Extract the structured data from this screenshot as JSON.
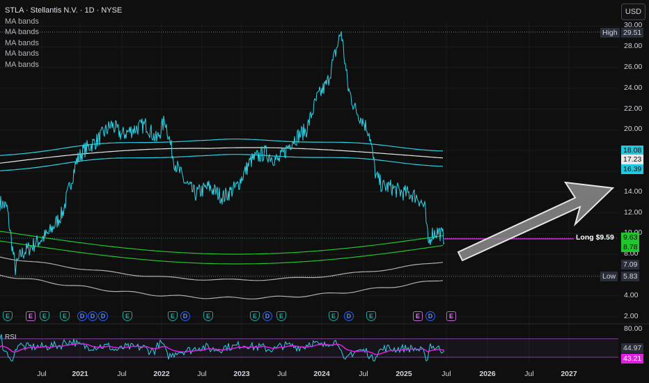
{
  "header": {
    "symbol_line": "STLA · Stellantis N.V. · 1D · NYSE",
    "indicators": [
      "MA bands",
      "MA bands",
      "MA bands",
      "MA bands",
      "MA bands"
    ],
    "currency_button": "USD"
  },
  "price_axis": {
    "ticks": [
      "30.00",
      "28.00",
      "26.00",
      "24.00",
      "22.00",
      "20.00",
      "18.00",
      "16.00",
      "14.00",
      "12.00",
      "10.00",
      "8.00",
      "6.00",
      "4.00",
      "2.00"
    ],
    "tick_values": [
      30,
      28,
      26,
      24,
      22,
      20,
      18,
      16,
      14,
      12,
      10,
      8,
      6,
      4,
      2
    ],
    "high_label": "High",
    "high_value": "29.51",
    "low_label": "Low",
    "low_value": "5.83",
    "band_upper": "18.08",
    "band_mid": "17.23",
    "band_lower": "16.39",
    "current_price": "9.63",
    "green_level": "8.78",
    "gray_level": "7.09"
  },
  "rsi": {
    "label": "RSI",
    "axis_top": "80.00",
    "value_1": "44.97",
    "value_2": "43.21"
  },
  "time_axis": {
    "labels": [
      {
        "text": "Jul",
        "year": false
      },
      {
        "text": "2021",
        "year": true
      },
      {
        "text": "Jul",
        "year": false
      },
      {
        "text": "2022",
        "year": true
      },
      {
        "text": "Jul",
        "year": false
      },
      {
        "text": "2023",
        "year": true
      },
      {
        "text": "Jul",
        "year": false
      },
      {
        "text": "2024",
        "year": true
      },
      {
        "text": "Jul",
        "year": false
      },
      {
        "text": "2025",
        "year": true
      },
      {
        "text": "Jul",
        "year": false
      },
      {
        "text": "2026",
        "year": true
      },
      {
        "text": "Jul",
        "year": false
      },
      {
        "text": "2027",
        "year": true
      }
    ]
  },
  "events": [
    "E",
    "E",
    "E",
    "E",
    "D",
    "D",
    "D",
    "E",
    "E",
    "D",
    "E",
    "E",
    "D",
    "E",
    "E",
    "D",
    "E",
    "E",
    "D",
    "E"
  ],
  "annotation": {
    "long_label": "Long $9.59"
  },
  "colors": {
    "background": "#0f0f0f",
    "price_line": "#2ed3e6",
    "band_cyan": "#2ed3e6",
    "band_white": "#e8e8e8",
    "band_green": "#22c52e",
    "band_gray": "#b0b0b0",
    "rsi_line": "#2ed3e6",
    "rsi_ma": "#e020e0",
    "long_line": "#e020e0",
    "arrow_fill": "#8c8c8c"
  }
}
